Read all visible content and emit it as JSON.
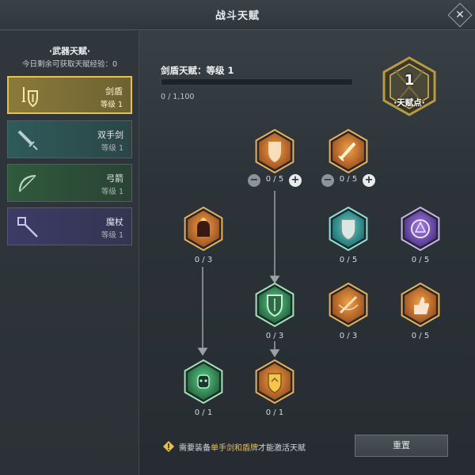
{
  "window": {
    "title": "战斗天赋"
  },
  "sidebar": {
    "title": "·武器天赋·",
    "daily_xp_label": "今日剩余可获取天赋经验：",
    "daily_xp_value": "0",
    "weapons": [
      {
        "name": "剑盾",
        "level": "等级 1",
        "icon": "sword-shield-icon",
        "selected": true
      },
      {
        "name": "双手剑",
        "level": "等级 1",
        "icon": "greatsword-icon",
        "selected": false
      },
      {
        "name": "弓箭",
        "level": "等级 1",
        "icon": "bow-icon",
        "selected": false
      },
      {
        "name": "魔杖",
        "level": "等级 1",
        "icon": "staff-icon",
        "selected": false
      }
    ]
  },
  "main": {
    "talent_header": "剑盾天赋：等级 1",
    "xp_current": 0,
    "xp_max": 1100,
    "xp_text": "0 / 1,100",
    "points": {
      "value": "1",
      "label": "·天赋点·"
    },
    "nodes": [
      {
        "id": "shield-bash",
        "icon": "shield-strike-icon",
        "count": "0 / 5",
        "tint": "orange",
        "show_pm": true
      },
      {
        "id": "blade-glint",
        "icon": "glinting-sword-icon",
        "count": "0 / 5",
        "tint": "orange",
        "show_pm": true
      },
      {
        "id": "fire-fist",
        "icon": "flaming-fist-icon",
        "count": "0 / 3",
        "tint": "orange",
        "show_pm": false
      },
      {
        "id": "iron-shield",
        "icon": "shield-icon",
        "count": "0 / 5",
        "tint": "teal",
        "show_pm": false
      },
      {
        "id": "arcane-seal",
        "icon": "arcane-seal-icon",
        "count": "0 / 5",
        "tint": "purple",
        "show_pm": false
      },
      {
        "id": "shield-wall",
        "icon": "shield-wall-icon",
        "count": "0 / 3",
        "tint": "green",
        "show_pm": false
      },
      {
        "id": "whirl-blade",
        "icon": "whirlwind-sword-icon",
        "count": "0 / 3",
        "tint": "orange",
        "show_pm": false
      },
      {
        "id": "thumbs-up",
        "icon": "thumbs-up-icon",
        "count": "0 / 5",
        "tint": "orange",
        "show_pm": false
      },
      {
        "id": "guardian",
        "icon": "guardian-mask-icon",
        "count": "0 / 1",
        "tint": "green",
        "show_pm": false
      },
      {
        "id": "golden-crest",
        "icon": "golden-crest-icon",
        "count": "0 / 1",
        "tint": "orange",
        "show_pm": false
      }
    ],
    "minus_label": "−",
    "plus_label": "+"
  },
  "footer": {
    "warning_prefix": "需要装备",
    "warning_highlight": "单手剑和盾牌",
    "warning_suffix": "才能激活天赋",
    "reset_label": "重置"
  },
  "colors": {
    "accent_gold": "#e6c24a",
    "highlight_text": "#e8c24e",
    "tint_orange": "#e0883a",
    "tint_teal": "#3fb3a9",
    "tint_purple": "#8a62c8",
    "tint_green": "#3fa56a"
  }
}
